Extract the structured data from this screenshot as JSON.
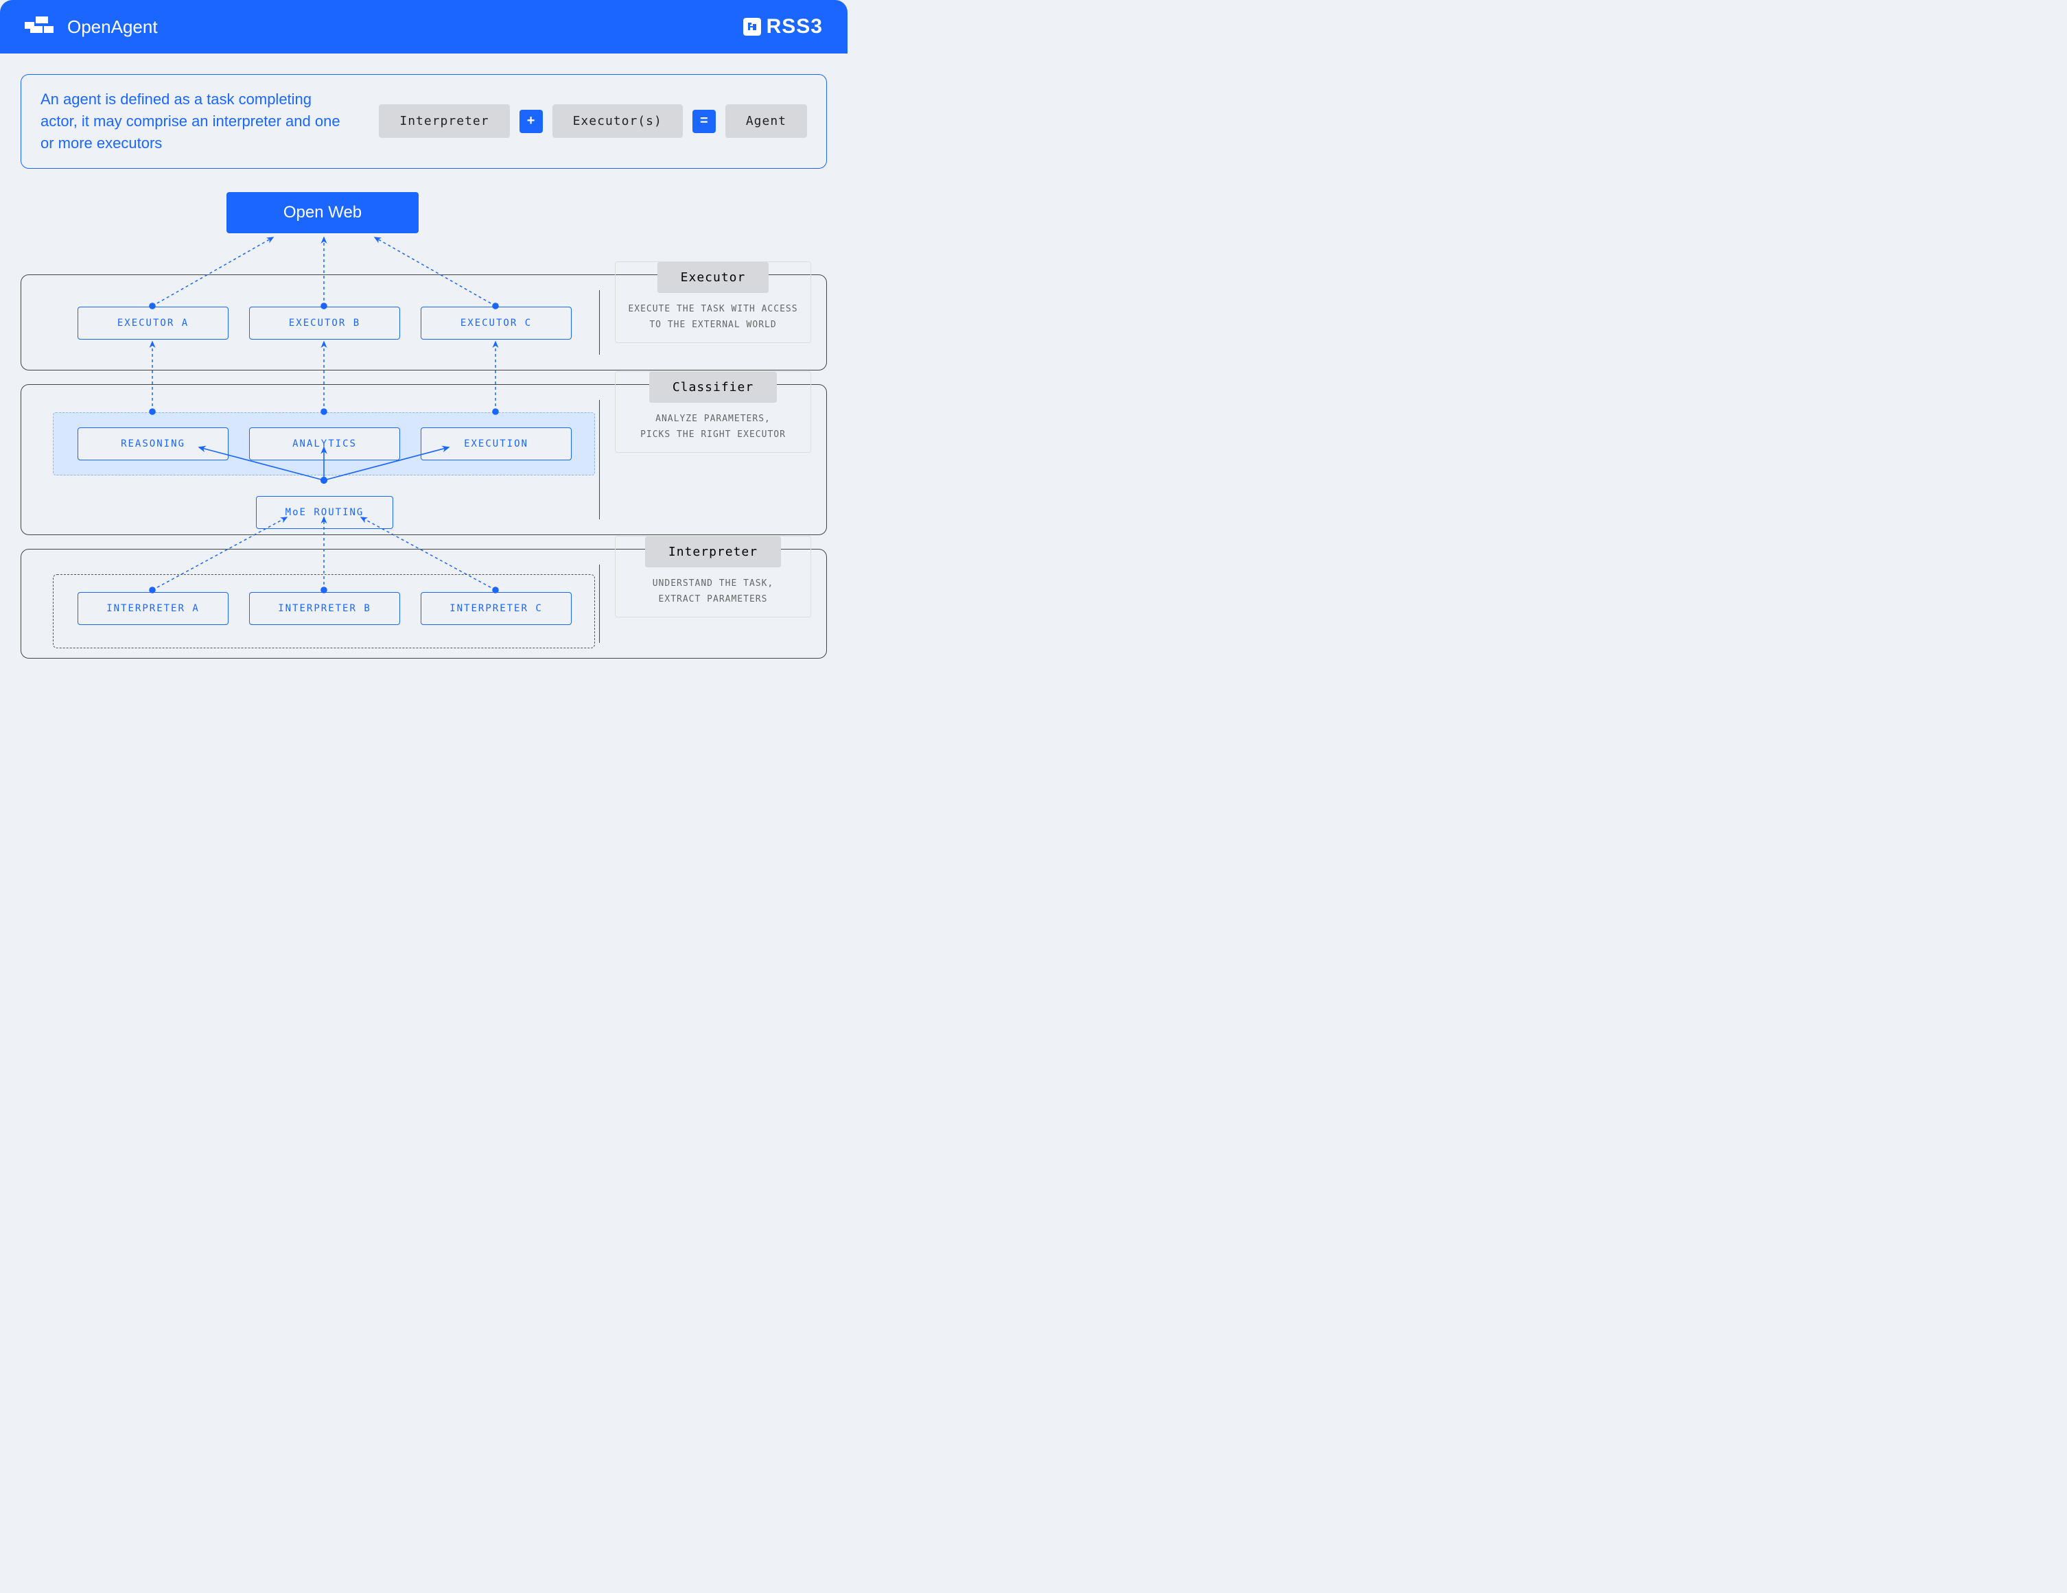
{
  "header": {
    "title": "OpenAgent",
    "brand": "RSS3"
  },
  "definition": {
    "text": "An agent is defined as a task completing actor, it may comprise an interpreter and one or more executors",
    "eq": {
      "interpreter": "Interpreter",
      "plus": "+",
      "executors": "Executor(s)",
      "equals": "=",
      "agent": "Agent"
    }
  },
  "diagram": {
    "openweb": "Open Web",
    "executors": {
      "a": "EXECUTOR A",
      "b": "EXECUTOR B",
      "c": "EXECUTOR C"
    },
    "classifier": {
      "reasoning": "REASONING",
      "analytics": "ANALYTICS",
      "execution": "EXECUTION",
      "moe": "MoE ROUTING"
    },
    "interpreters": {
      "a": "INTERPRETER A",
      "b": "INTERPRETER B",
      "c": "INTERPRETER C"
    }
  },
  "panels": {
    "executor": {
      "title": "Executor",
      "desc": "EXECUTE THE TASK WITH ACCESS TO THE EXTERNAL WORLD"
    },
    "classifier": {
      "title": "Classifier",
      "desc1": "ANALYZE PARAMETERS,",
      "desc2": "PICKS THE RIGHT EXECUTOR"
    },
    "interpreter": {
      "title": "Interpreter",
      "desc1": "UNDERSTAND THE TASK,",
      "desc2": "EXTRACT PARAMETERS"
    }
  }
}
